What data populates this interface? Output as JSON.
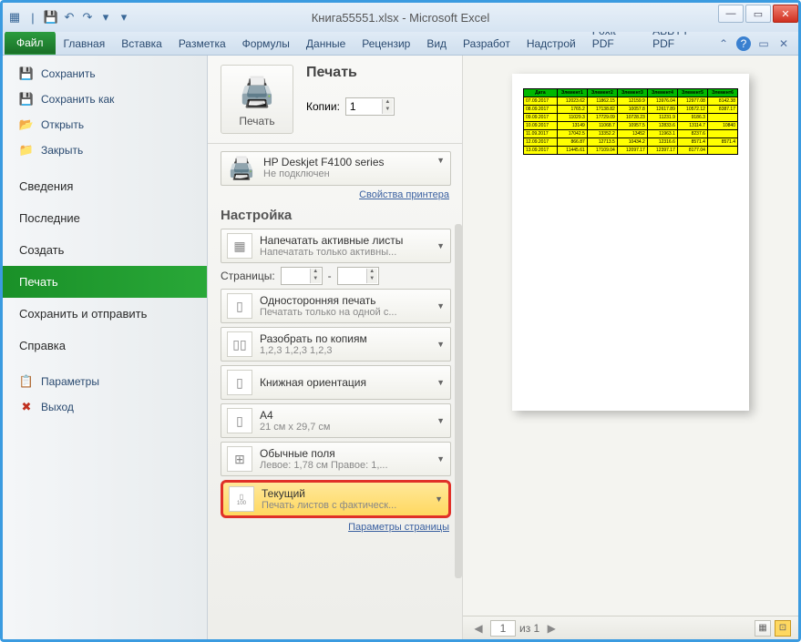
{
  "window": {
    "title": "Книга55551.xlsx - Microsoft Excel"
  },
  "ribbon": {
    "file": "Файл",
    "tabs": [
      "Главная",
      "Вставка",
      "Разметка",
      "Формулы",
      "Данные",
      "Рецензир",
      "Вид",
      "Разработ",
      "Надстрой",
      "Foxit PDF",
      "ABBYY PDF"
    ]
  },
  "left": {
    "save": "Сохранить",
    "saveas": "Сохранить как",
    "open": "Открыть",
    "close": "Закрыть",
    "info": "Сведения",
    "recent": "Последние",
    "new": "Создать",
    "print": "Печать",
    "saveSend": "Сохранить и отправить",
    "help": "Справка",
    "options": "Параметры",
    "exit": "Выход"
  },
  "print": {
    "title": "Печать",
    "button": "Печать",
    "copies_label": "Копии:",
    "copies_value": "1",
    "printer_name": "HP Deskjet F4100 series",
    "printer_status": "Не подключен",
    "printer_props": "Свойства принтера",
    "settings_title": "Настройка",
    "opt1_title": "Напечатать активные листы",
    "opt1_sub": "Напечатать только активны...",
    "pages_label": "Страницы:",
    "pages_sep": "-",
    "opt2_title": "Односторонняя печать",
    "opt2_sub": "Печатать только на одной с...",
    "opt3_title": "Разобрать по копиям",
    "opt3_sub": "1,2,3   1,2,3   1,2,3",
    "opt4_title": "Книжная ориентация",
    "opt5_title": "A4",
    "opt5_sub": "21 см x 29,7 см",
    "opt6_title": "Обычные поля",
    "opt6_sub": "Левое: 1,78 см   Правое: 1,...",
    "opt7_title": "Текущий",
    "opt7_sub": "Печать листов с фактическ...",
    "page_setup": "Параметры страницы"
  },
  "preview": {
    "page_current": "1",
    "page_of": "из 1",
    "table": {
      "headers": [
        "Дата",
        "Элемент1",
        "Элемент2",
        "Элемент3",
        "Элемент4",
        "Элемент5",
        "Элемент6"
      ],
      "rows": [
        [
          "07.09.2017",
          "12023.62",
          "11862.15",
          "12159.9",
          "13976.04",
          "12977.08",
          "8142.38"
        ],
        [
          "08.09.2017",
          "1765.2",
          "17138.82",
          "10057.8",
          "12617.89",
          "10572.12",
          "8387.17"
        ],
        [
          "09.09.2017",
          "11029.3",
          "17729.09",
          "10728.23",
          "11231.9",
          "9186.3"
        ],
        [
          "10.09.2017",
          "13149",
          "11068.7",
          "10957.5",
          "12833.6",
          "13114.7",
          "10840"
        ],
        [
          "11.09.2017",
          "17042.5",
          "13352.2",
          "13452",
          "11963.1",
          "8237.6"
        ],
        [
          "12.09.2017",
          "866.87",
          "12713.5",
          "10434.2",
          "12316.6",
          "8571.4",
          "8571.4"
        ],
        [
          "13.09.2017",
          "11445.61",
          "17109.04",
          "12097.17",
          "12397.17",
          "8177.04"
        ]
      ]
    }
  }
}
